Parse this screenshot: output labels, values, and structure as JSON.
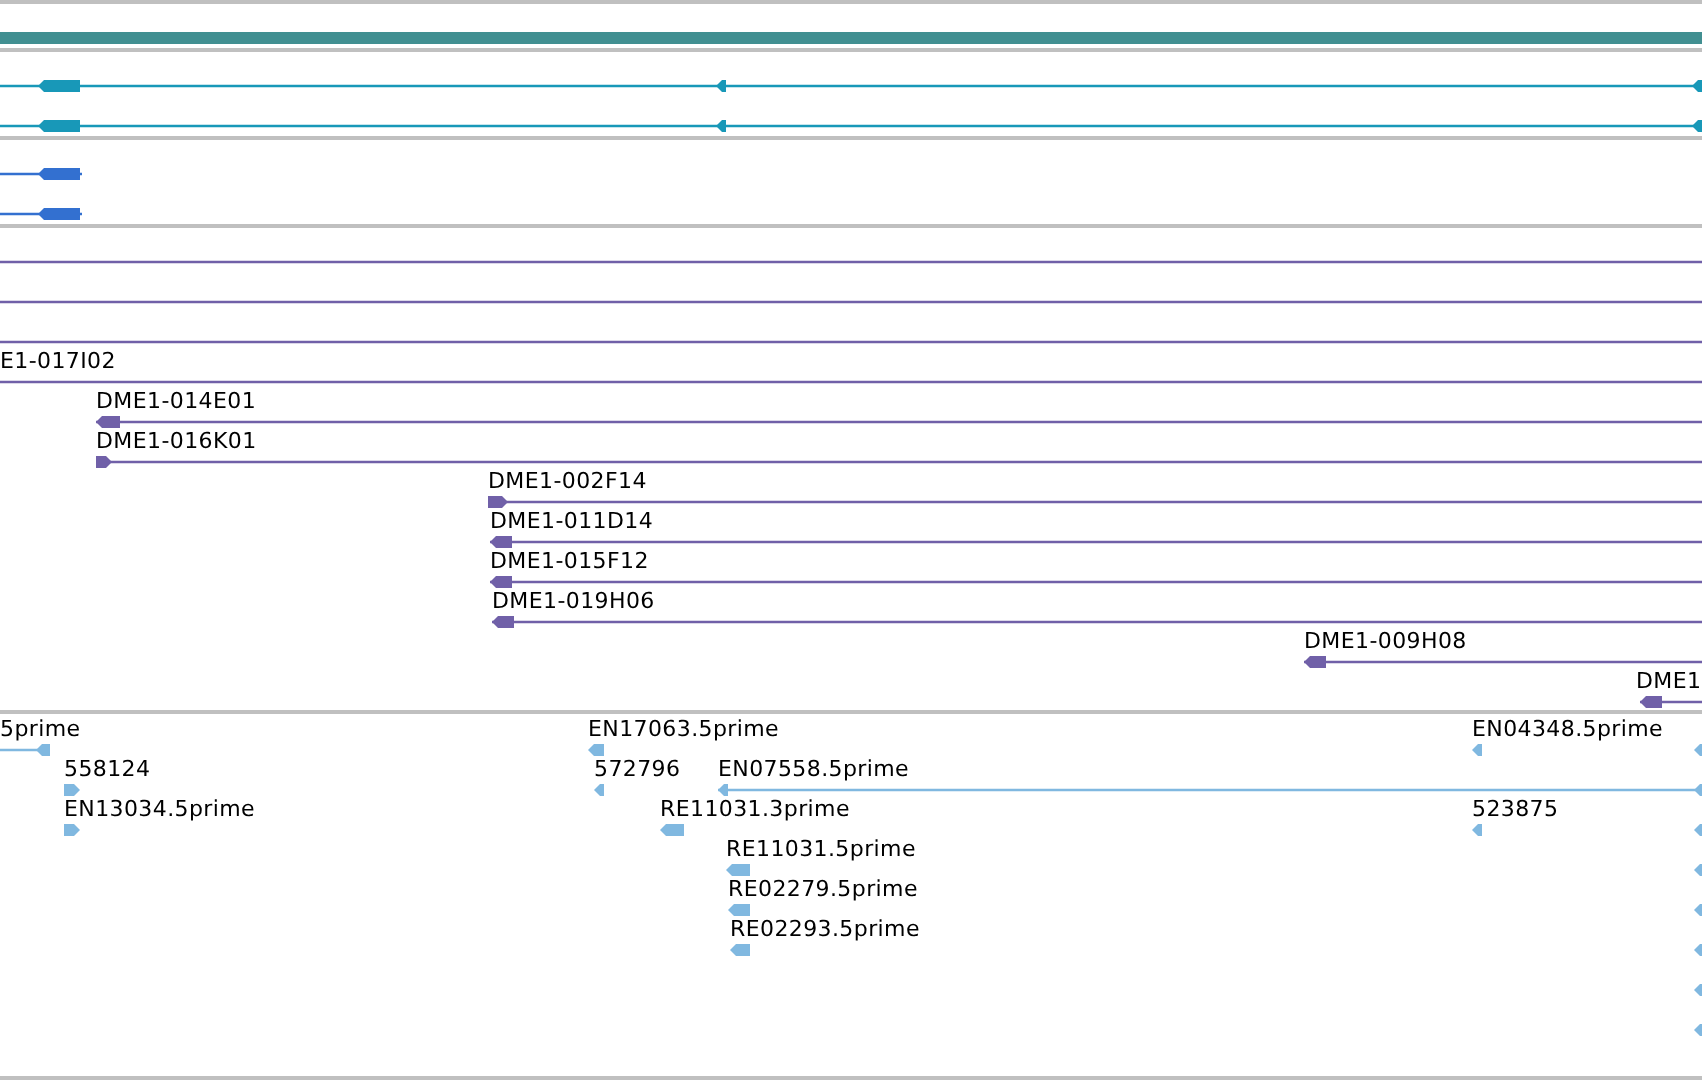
{
  "tracks": [
    {
      "kind": "overview"
    },
    {
      "kind": "transcripts",
      "rows": [
        {
          "reverse": true
        },
        {
          "reverse": true
        }
      ]
    },
    {
      "kind": "genes",
      "rows": [
        {
          "reverse": true
        },
        {
          "reverse": true
        }
      ]
    },
    {
      "kind": "clones",
      "rows": [
        {
          "features": [
            {
              "kind": "line"
            }
          ]
        },
        {
          "features": [
            {
              "kind": "line"
            }
          ]
        },
        {
          "features": [
            {
              "kind": "line"
            }
          ]
        },
        {
          "features": [
            {
              "kind": "line",
              "label": "E1-017I02"
            }
          ]
        },
        {
          "features": [
            {
              "kind": "clone",
              "label": "DME1-014E01",
              "reverse": true
            }
          ]
        },
        {
          "features": [
            {
              "kind": "clone",
              "label": "DME1-016K01",
              "reverse": false
            }
          ]
        },
        {
          "features": [
            {
              "kind": "clone",
              "label": "DME1-002F14",
              "reverse": false
            }
          ]
        },
        {
          "features": [
            {
              "kind": "clone",
              "label": "DME1-011D14",
              "reverse": true
            }
          ]
        },
        {
          "features": [
            {
              "kind": "clone",
              "label": "DME1-015F12",
              "reverse": true
            }
          ]
        },
        {
          "features": [
            {
              "kind": "clone",
              "label": "DME1-019H06",
              "reverse": true
            }
          ]
        },
        {
          "features": [
            {
              "kind": "clone",
              "label": "DME1-009H08",
              "reverse": true
            }
          ]
        },
        {
          "features": [
            {
              "kind": "clone",
              "label": "DME1",
              "reverse": true
            }
          ]
        }
      ]
    },
    {
      "kind": "ests",
      "rows": [
        {
          "features": [
            {
              "label": "5prime",
              "reverse": true
            },
            {
              "label": "EN17063.5prime",
              "reverse": true
            },
            {
              "label": "EN04348.5prime",
              "reverse": true
            },
            {
              "reverse": true
            }
          ]
        },
        {
          "features": [
            {
              "label": "558124",
              "reverse": false
            },
            {
              "label": "572796",
              "reverse": true
            },
            {
              "label": "EN07558.5prime",
              "reverse": true
            },
            {
              "reverse": true
            }
          ]
        },
        {
          "features": [
            {
              "label": "EN13034.5prime",
              "reverse": false
            },
            {
              "label": "RE11031.3prime",
              "reverse": true
            },
            {
              "label": "523875",
              "reverse": true
            },
            {
              "reverse": true
            }
          ]
        },
        {
          "features": [
            {
              "label": "RE11031.5prime",
              "reverse": true
            },
            {
              "reverse": true
            }
          ]
        },
        {
          "features": [
            {
              "label": "RE02279.5prime",
              "reverse": true
            },
            {
              "reverse": true
            }
          ]
        },
        {
          "features": [
            {
              "label": "RE02293.5prime",
              "reverse": true
            },
            {
              "reverse": true
            }
          ]
        },
        {
          "features": [
            {
              "reverse": true
            }
          ]
        },
        {
          "features": [
            {
              "reverse": true
            }
          ]
        }
      ]
    }
  ]
}
